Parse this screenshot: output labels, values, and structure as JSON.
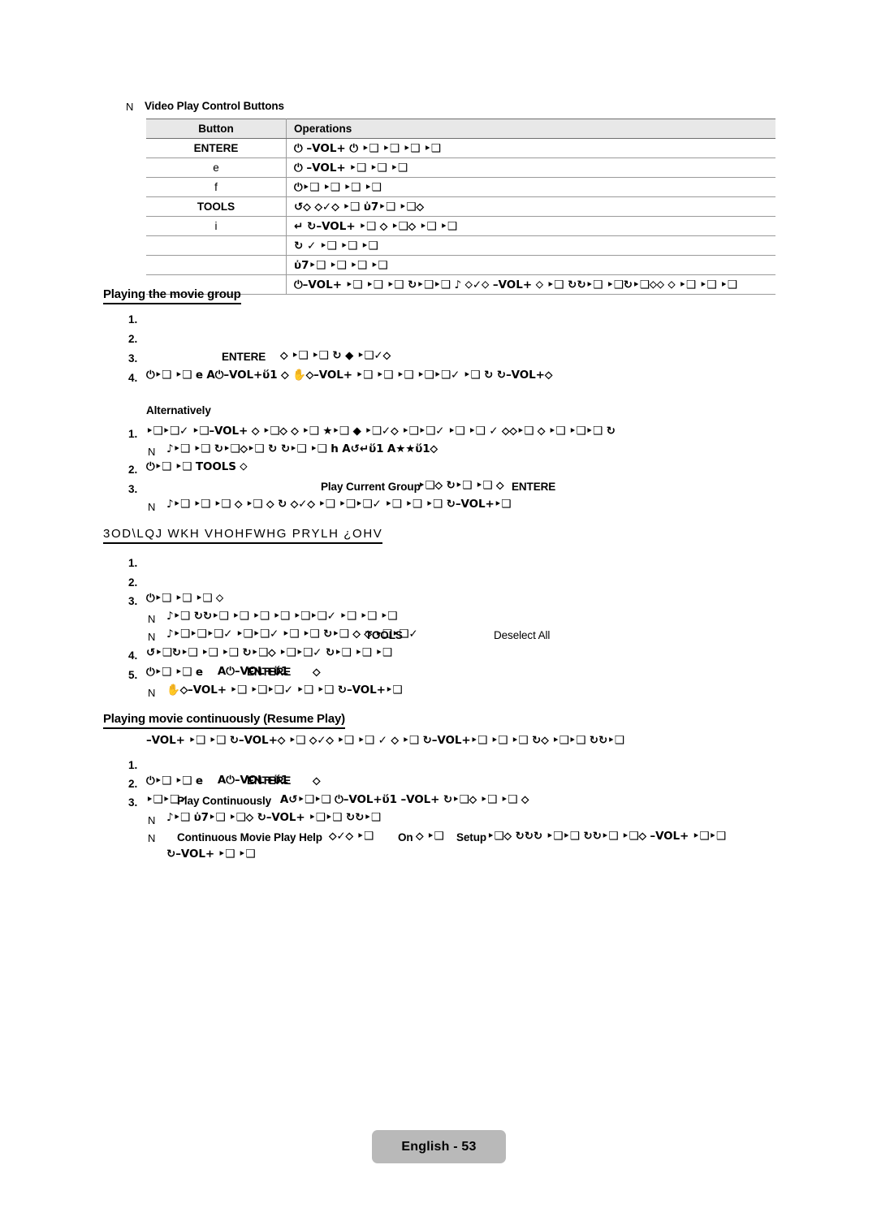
{
  "document": {
    "footer_label": "English - 53",
    "page_number": "53",
    "language": "English"
  },
  "note_marker": "N",
  "video_table_note": {
    "marker": "N",
    "title": "Video Play Control Buttons"
  },
  "table": {
    "headers": [
      "Button",
      "Operations"
    ],
    "rows": [
      {
        "button": "ENTERE",
        "button_bold": true,
        "operations": "⏻ –VOL+ ⏻ ‣❑ ‣❑ ‣❑ ‣❑"
      },
      {
        "button": "e",
        "button_bold": false,
        "operations": "⏻ –VOL+ ‣❑ ‣❑ ‣❑"
      },
      {
        "button": "f",
        "button_bold": false,
        "operations": "⏻‣❑ ‣❑ ‣❑ ‣❑"
      },
      {
        "button": "TOOLS",
        "button_bold": true,
        "operations": "↺⬦  ⬦✓⬦  ‣❑ ὐ7‣❑ ‣❑⬦"
      },
      {
        "button": "i",
        "button_bold": false,
        "operations": "↵ ↻–VOL+ ‣❑ ⬦ ‣❑⬦  ‣❑ ‣❑"
      },
      {
        "button": "",
        "button_bold": false,
        "operations": "↻  ✓  ‣❑ ‣❑ ‣❑"
      },
      {
        "button": "",
        "button_bold": false,
        "operations": "ὐ7‣❑ ‣❑  ‣❑ ‣❑"
      },
      {
        "button": "",
        "button_bold": false,
        "operations": "⏻–VOL+ ‣❑ ‣❑  ‣❑ ↻‣❑‣❑ ♪ ⬦✓⬦ –VOL+ ⬦ ‣❑ ↻↻‣❑ ‣❑↻‣❑⬦⬦ ⬦ ‣❑ ‣❑ ‣❑"
      }
    ]
  },
  "sections": [
    {
      "id": "playing-the-movie-group",
      "heading": "Playing the movie group",
      "items": [
        {
          "num": "1.",
          "text": ""
        },
        {
          "num": "2.",
          "text": ""
        },
        {
          "num": "3.",
          "label": "ENTERE",
          "text": "⬦ ‣❑ ‣❑ ↻ ◆ ‣❑✓⬦"
        },
        {
          "num": "4.",
          "text": "⏻‣❑ ‣❑ e   ὏A⏻–VOL+ὕ1 ⬦ ✋⬦–VOL+ ‣❑ ‣❑  ‣❑ ‣❑‣❑✓ ‣❑ ↻   ↻–VOL+⬦"
        }
      ],
      "alternatively": {
        "label": "Alternatively",
        "items": [
          {
            "num": "1.",
            "text": "‣❑‣❑✓  ‣❑–VOL+ ⬦ ‣❑⬦ ⬦ ‣❑ ★‣❑ ◆ ‣❑✓⬦ ‣❑‣❑✓  ‣❑ ‣❑ ✓ ⬦⬦‣❑ ⬦ ‣❑ ‣❑‣❑ ↻"
          },
          {
            "marker": "N",
            "text": "♪‣❑ ‣❑ ↻‣❑⬦‣❑ ↻ ↻‣❑ ‣❑        h   ὏A↺↵ὕ1    ὏A★★ὕ1⬦"
          },
          {
            "num": "2.",
            "text": "⏻‣❑ ‣❑ TOOLS ⬦"
          },
          {
            "num": "3.",
            "label": "Play Current Group",
            "label2": "ENTERE",
            "text": "‣❑⬦ ↻‣❑ ‣❑      ⬦"
          },
          {
            "marker": "N",
            "text": "♪‣❑ ‣❑ ‣❑ ⬦ ‣❑ ⬦ ↻ ⬦✓⬦ ‣❑ ‣❑‣❑✓ ‣❑ ‣❑ ‣❑ ↻–VOL+‣❑"
          }
        ]
      }
    },
    {
      "id": "playing-the-selected-movie-files",
      "heading_cipher": "3OD\\LQJ WKH VHOHFWHG PRYLH ¿OHV",
      "heading_plain": "Playing the selected movie files",
      "items": [
        {
          "num": "1.",
          "text": ""
        },
        {
          "num": "2.",
          "text": ""
        },
        {
          "num": "3.",
          "text": "⏻‣❑ ‣❑ ‣❑ ⬦"
        },
        {
          "marker": "N",
          "text": "♪‣❑   ↻↻‣❑ ‣❑ ‣❑ ‣❑ ‣❑‣❑✓ ‣❑ ‣❑ ‣❑"
        },
        {
          "marker": "N",
          "label": "TOOLS",
          "label2": "Deselect All",
          "text": "♪‣❑‣❑‣❑✓  ‣❑‣❑✓ ‣❑ ‣❑ ↻‣❑         ⬦ ⬦ ‣❑‣❑✓"
        },
        {
          "num": "4.",
          "text": "↺‣❑↻‣❑ ‣❑ ‣❑ ↻‣❑⬦  ‣❑‣❑✓ ↻‣❑ ‣❑ ‣❑"
        },
        {
          "num": "5.",
          "overlap_a": "὏A⏻–VOL+ὕ1",
          "overlap_b": "ENTERE",
          "text": "⏻‣❑ ‣❑ e",
          "tail": "⬦"
        },
        {
          "marker": "N",
          "text": "✋⬦–VOL+ ‣❑ ‣❑‣❑✓ ‣❑ ‣❑  ↻–VOL+‣❑"
        }
      ]
    },
    {
      "id": "playing-movie-continuously",
      "heading": "Playing movie continuously (Resume Play)",
      "intro": "–VOL+ ‣❑ ‣❑ ↻–VOL+⬦ ‣❑ ⬦✓⬦ ‣❑ ‣❑ ✓ ⬦ ‣❑ ↻–VOL+‣❑ ‣❑ ‣❑ ↻⬦ ‣❑‣❑  ↻↻‣❑",
      "items": [
        {
          "num": "1.",
          "text": ""
        },
        {
          "num": "2.",
          "overlap_a": "὏A⏻–VOL+ὕ1",
          "overlap_b": "ENTERE",
          "text": "⏻‣❑ ‣❑ e",
          "tail": "⬦"
        },
        {
          "num": "3.",
          "label": "Play Continuously",
          "text": "‣❑‣❑✓",
          "tail": "὏A↺‣❑‣❑ ⏻–VOL+ὕ1 –VOL+ ↻‣❑⬦ ‣❑ ‣❑ ⬦"
        },
        {
          "marker": "N",
          "text": "♪‣❑ ὐ7‣❑ ‣❑⬦ ↻–VOL+ ‣❑‣❑ ↻↻‣❑"
        },
        {
          "marker": "N",
          "label": "Continuous Movie Play Help",
          "label2": "On",
          "label3": "Setup",
          "text": "⬦✓⬦ ‣❑",
          "tail": "⬦ ‣❑",
          "tail2": "‣❑⬦ ↻↻↻ ‣❑‣❑ ↻↻‣❑ ‣❑⬦ –VOL+ ‣❑‣❑"
        },
        {
          "marker": "",
          "text": "↻–VOL+ ‣❑ ‣❑"
        }
      ]
    }
  ]
}
